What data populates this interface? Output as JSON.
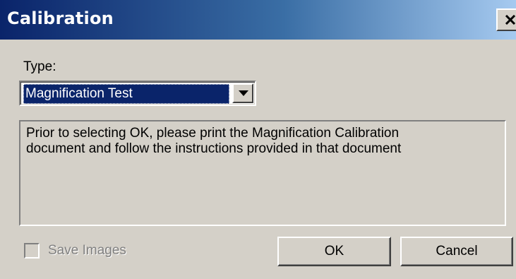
{
  "window": {
    "title": "Calibration",
    "close_glyph": "×",
    "close_icon": "close-icon"
  },
  "type_field": {
    "label": "Type:",
    "selected_value": "Magnification Test",
    "dropdown_icon": "chevron-down-icon"
  },
  "info": {
    "text": "Prior to selecting OK, please print the Magnification Calibration\ndocument and follow the instructions provided in that document"
  },
  "save_images": {
    "label": "Save Images",
    "checked": false,
    "enabled": false
  },
  "buttons": {
    "ok_label": "OK",
    "cancel_label": "Cancel"
  },
  "colors": {
    "titlebar_start": "#0a246a",
    "titlebar_end": "#a6caf0",
    "face": "#d4d0c8",
    "selection": "#0a246a"
  }
}
